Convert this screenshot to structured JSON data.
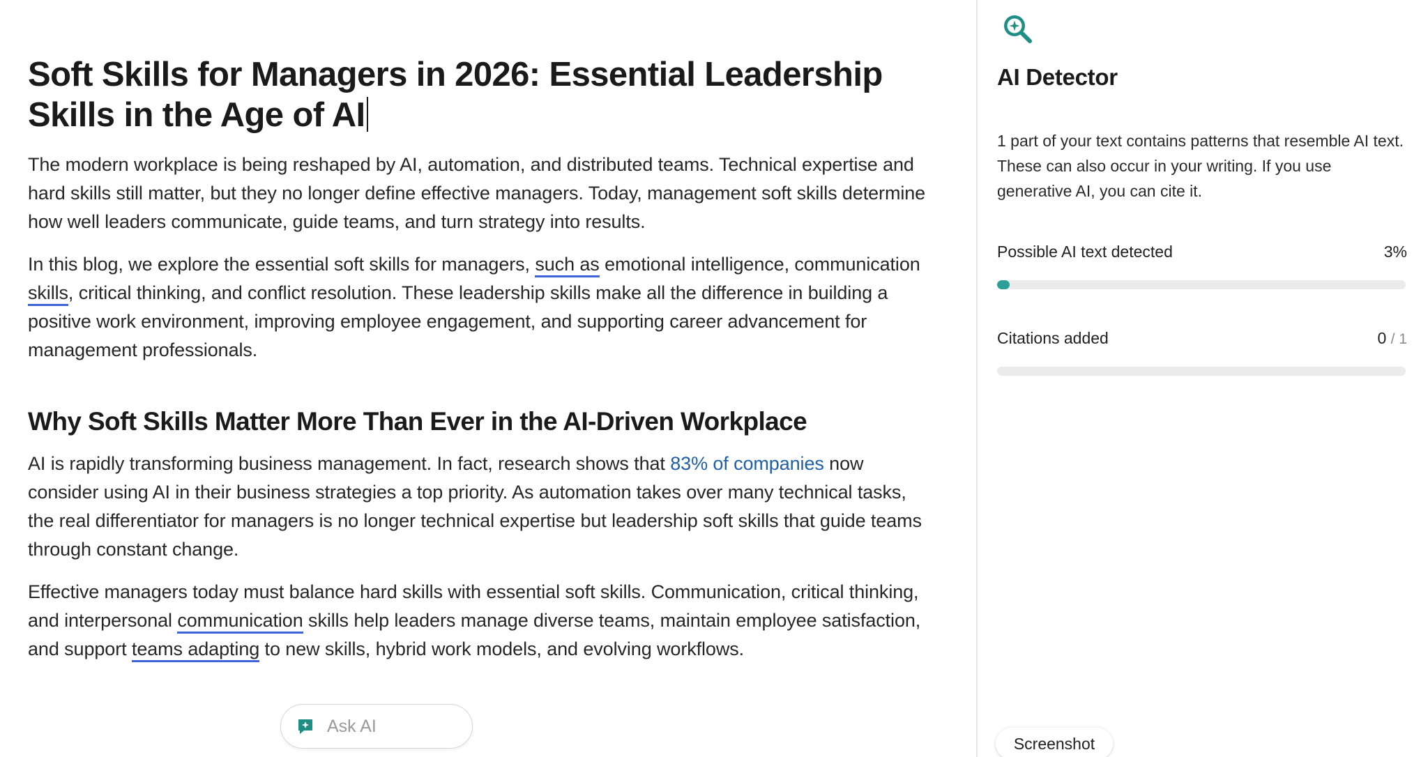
{
  "document": {
    "title": "Soft Skills for Managers in 2026: Essential Leadership Skills in the Age of AI",
    "p1": "The modern workplace is being reshaped by AI, automation, and distributed teams. Technical expertise and hard skills still matter, but they no longer define effective managers. Today, management soft skills determine how well leaders communicate, guide teams, and turn strategy into results.",
    "p2": {
      "t1": "In this blog, we explore the essential soft skills for managers, ",
      "u1": "such as",
      "t2": " emotional intelligence, communication ",
      "u2": "skills",
      "t3": ", critical thinking, and conflict resolution. These leadership skills make all the difference in building a positive work environment, improving employee engagement, and supporting career advancement for management professionals."
    },
    "heading2": "Why Soft Skills Matter More Than Ever in the AI-Driven Workplace",
    "p3": {
      "t1": "AI is rapidly transforming business management. In fact, research shows that ",
      "link": "83% of companies",
      "t2": " now consider using AI in their business strategies a top priority. As automation takes over many technical tasks, the real differentiator for managers is no longer technical expertise but leadership soft skills that guide teams through constant change."
    },
    "p4": {
      "t1": "Effective managers today must balance hard skills with essential soft skills. Communication, critical thinking, and interpersonal ",
      "u1": "communication",
      "t2": " skills help leaders manage diverse teams, maintain employee satisfaction, and support ",
      "u2": "teams adapting",
      "t3": " to new skills, hybrid work models, and evolving workflows."
    }
  },
  "ask_ai": {
    "placeholder": "Ask AI",
    "icon": "sparkle-chat-icon"
  },
  "panel": {
    "logo_icon": "ai-detector-search-icon",
    "title": "AI Detector",
    "description": "1 part of your text contains patterns that resemble AI text. These can also occur in your writing. If you use generative AI, you can cite it.",
    "ai_text": {
      "label": "Possible AI text detected",
      "value_text": "3%",
      "percent": 3
    },
    "citations": {
      "label": "Citations added",
      "count": "0",
      "total": "/ 1",
      "percent": 0
    }
  },
  "screenshot_chip": {
    "label": "Screenshot"
  },
  "colors": {
    "accent_teal": "#1f8f86",
    "progress_fill": "#2aa098",
    "underline_blue": "#3f63d8",
    "link_blue": "#1f5fa8"
  }
}
